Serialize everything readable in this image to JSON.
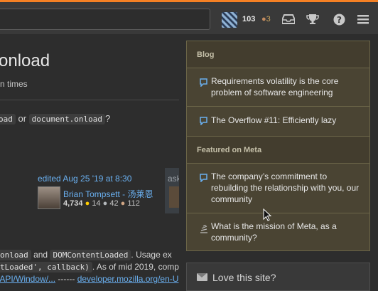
{
  "topbar": {
    "reputation": "103",
    "badge_bullet": "●",
    "badge_count": "3",
    "icons": [
      "inbox-icon",
      "achievements-trophy-icon",
      "help-icon",
      "menu-icon"
    ]
  },
  "question": {
    "title": "onload",
    "meta_fragment": "n times",
    "body_line": {
      "code1": "oad",
      "or": " or ",
      "code2": "document.onload",
      "end": "?"
    }
  },
  "answer": {
    "edited": "edited Aug 25 '19 at 8:30",
    "asked_fragment": "ask",
    "user_name": "Brian Tompsett - 汤莱恩",
    "reputation": "4,734",
    "gold": "14",
    "silver": "42",
    "bronze": "112"
  },
  "bottom_text": {
    "line1": {
      "code1": "onload",
      "and": " and ",
      "code2": "DOMContentLoaded",
      "tail": ". Usage ex"
    },
    "line2": {
      "code": "tLoaded', callback)",
      "tail": ". As of mid 2019, compa"
    },
    "line3": {
      "link1": "/API/Window/...",
      "sep": " ------ ",
      "link2": "developer.mozilla.org/en-U"
    }
  },
  "sidebar": {
    "blog_header": "Blog",
    "blog_items": [
      "Requirements volatility is the core problem of software engineering",
      "The Overflow #11: Efficiently lazy"
    ],
    "meta_header": "Featured on Meta",
    "meta_items": [
      "The company’s commitment to rebuilding the relationship with you, our community",
      "What is the mission of Meta, as a community?"
    ],
    "love_title": "Love this site?"
  },
  "colors": {
    "accent": "#f48024",
    "link": "#6ab0f0",
    "widget_bg": "#4a4433"
  }
}
